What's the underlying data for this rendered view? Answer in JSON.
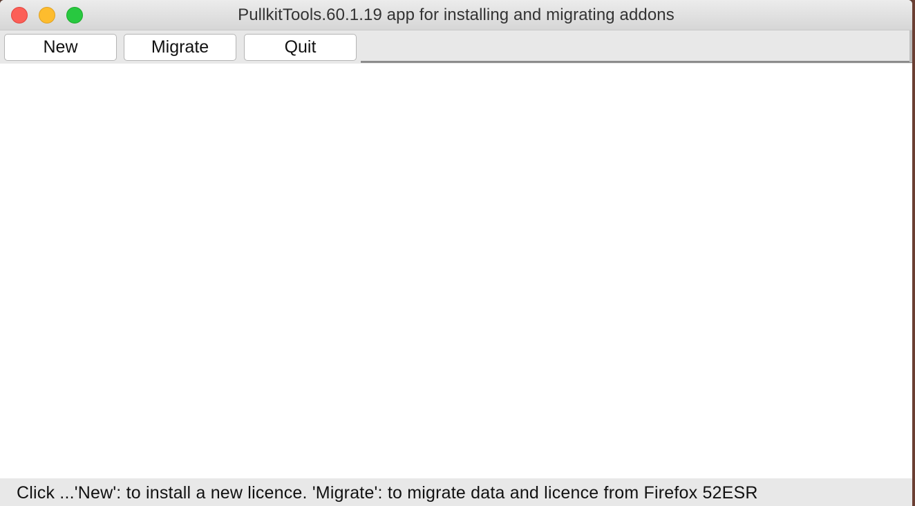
{
  "window": {
    "title": "PullkitTools.60.1.19 app for installing and migrating addons"
  },
  "titlebar": {
    "buttons": [
      {
        "name": "close",
        "icon": "close-icon",
        "color": "#fc5f57"
      },
      {
        "name": "minimize",
        "icon": "minimize-icon",
        "color": "#fdbc2e"
      },
      {
        "name": "zoom",
        "icon": "zoom-icon",
        "color": "#28c840"
      }
    ]
  },
  "toolbar": {
    "new_label": "New",
    "migrate_label": "Migrate",
    "quit_label": "Quit"
  },
  "statusbar": {
    "text": "Click ...'New': to install a new licence. 'Migrate': to migrate data and licence from Firefox 52ESR"
  }
}
